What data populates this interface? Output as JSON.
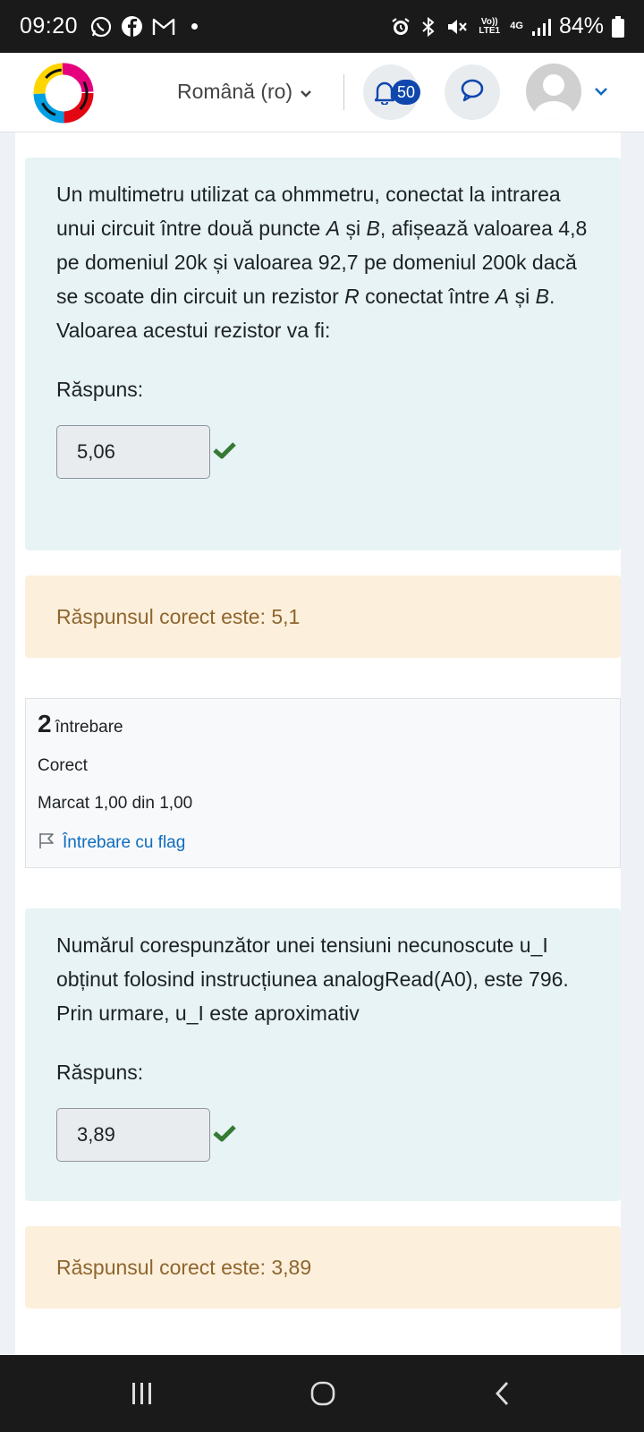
{
  "status_bar": {
    "time": "09:20",
    "left_icons": [
      "whatsapp-icon",
      "facebook-icon",
      "gmail-icon",
      "notification-dot-icon"
    ],
    "right_icons": [
      "alarm-icon",
      "bluetooth-icon",
      "mute-icon",
      "volte-icon",
      "4g-icon",
      "signal-icon"
    ],
    "volte_label": "Vo)) LTE1",
    "network_label": "4G",
    "battery": "84%"
  },
  "header": {
    "language": "Română (ro)",
    "notification_count": "50"
  },
  "questions": [
    {
      "text_parts": [
        "Un multimetru utilizat ca ohmmetru, conectat la intrarea unui circuit între două puncte ",
        "A",
        " și ",
        "B",
        ", afișează valoarea 4,8 pe domeniul 20k și valoarea 92,7 pe domeniul 200k dacă se scoate din circuit un rezistor ",
        "R",
        " conectat între ",
        "A",
        " și ",
        "B",
        ". Valoarea acestui rezistor va fi:"
      ],
      "answer_label": "Răspuns:",
      "answer_value": "5,06",
      "feedback": "Răspunsul corect este: 5,1"
    },
    {
      "number": "2",
      "number_label": "întrebare",
      "state": "Corect",
      "mark": "Marcat 1,00 din 1,00",
      "flag_label": "Întrebare cu flag",
      "text": "Numărul corespunzător unei tensiuni necunoscute u_I obținut folosind instrucțiunea analogRead(A0), este 796. Prin urmare, u_I  este aproximativ",
      "answer_label": "Răspuns:",
      "answer_value": "3,89",
      "feedback": "Răspunsul corect este: 3,89"
    }
  ],
  "colors": {
    "question_bg": "#e7f3f5",
    "feedback_bg": "#fcefdc",
    "feedback_text": "#8e662e",
    "check_green": "#357a32",
    "link_blue": "#0f6cbf",
    "badge_blue": "#0f47ad"
  }
}
